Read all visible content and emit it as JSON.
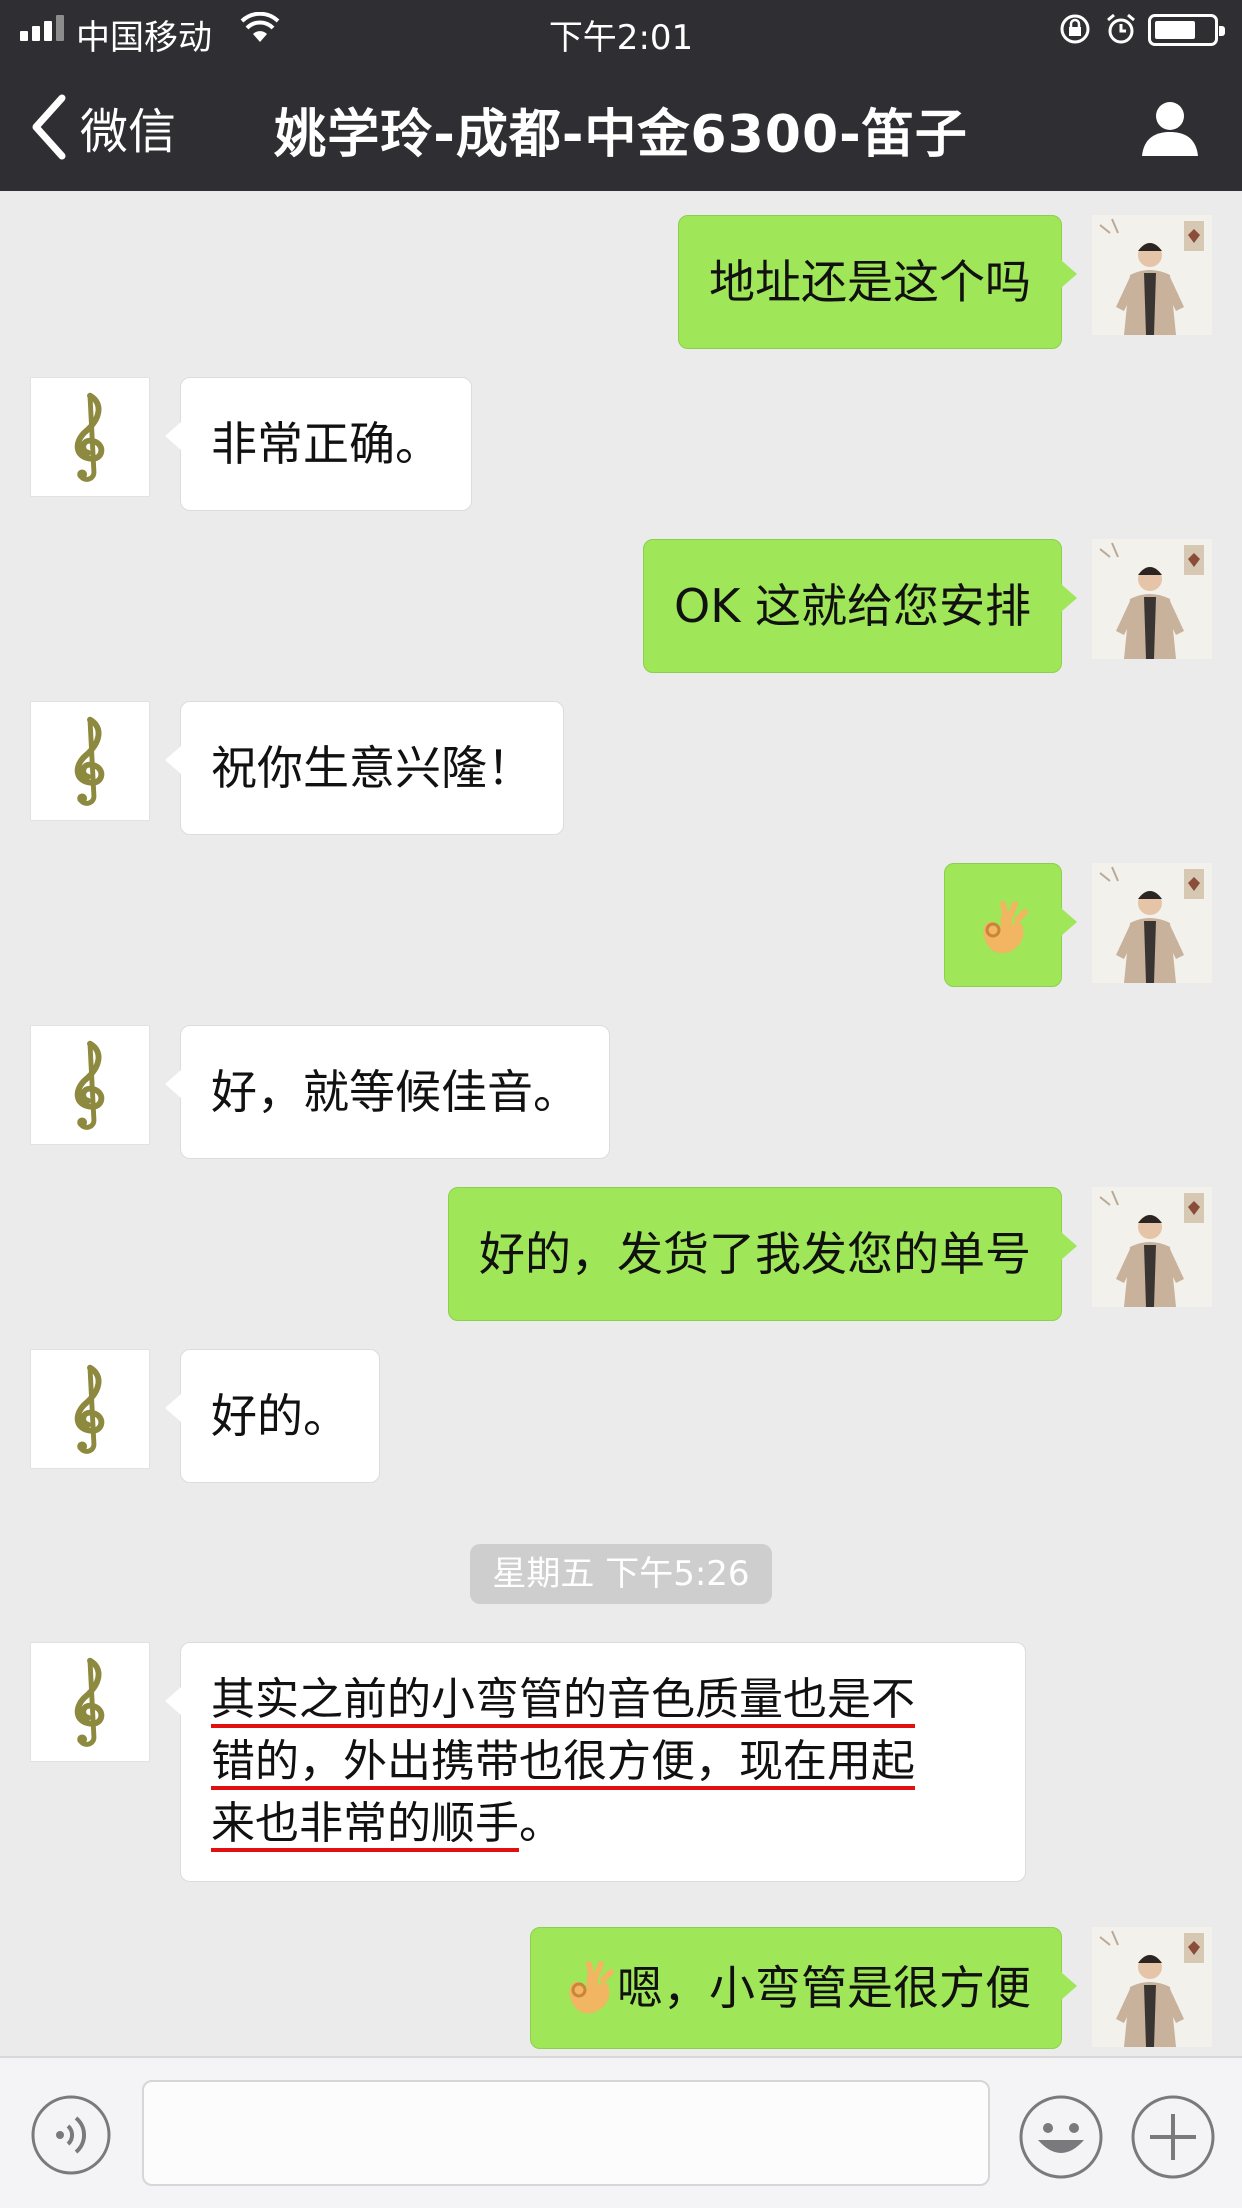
{
  "status_bar": {
    "carrier": "中国移动",
    "time": "下午2:01"
  },
  "nav": {
    "back_label": "微信",
    "title": "姚学玲-成都-中金6300-笛子"
  },
  "messages": [
    {
      "side": "right",
      "text": "地址还是这个吗"
    },
    {
      "side": "left",
      "text": "非常正确。"
    },
    {
      "side": "right",
      "text": "OK 这就给您安排"
    },
    {
      "side": "left",
      "text": "祝你生意兴隆！"
    },
    {
      "side": "right",
      "emoji": "ok-hand-emoji"
    },
    {
      "side": "left",
      "text": "好，就等候佳音。"
    },
    {
      "side": "right",
      "text": "好的，发货了我发您的单号"
    },
    {
      "side": "left",
      "text": "好的。"
    },
    {
      "side": "left",
      "lines": [
        "其实之前的小弯管的音色质量也是不",
        "错的，外出携带也很方便，现在用起",
        "来也非常的顺手",
        "。"
      ]
    },
    {
      "side": "right",
      "emoji": "ok-hand-emoji",
      "text": "嗯，小弯管是很方便"
    }
  ],
  "timestamp": "星期五 下午5:26",
  "input_bar": {
    "value": "",
    "icons": [
      "voice-icon",
      "emoji-face-icon",
      "plus-icon"
    ]
  },
  "colors": {
    "header_bg": "#2f2f33",
    "chat_bg": "#ebebeb",
    "bubble_self": "#9fe658",
    "bubble_other": "#ffffff",
    "underline_mark": "#e01010"
  }
}
